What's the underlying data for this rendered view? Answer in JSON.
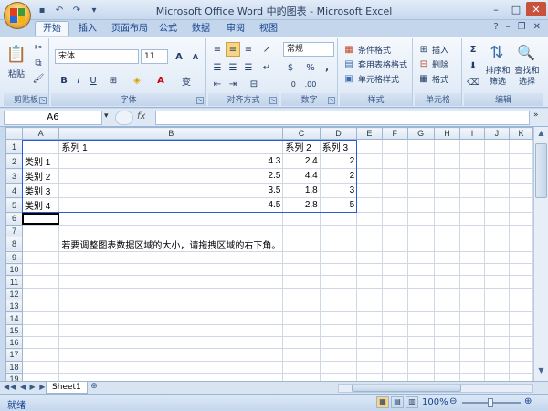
{
  "window": {
    "title": "Microsoft Office Word 中的图表 - Microsoft Excel",
    "minimize": "–",
    "maximize": "□",
    "close": "✕"
  },
  "tabs": [
    {
      "label": "开始",
      "active": true
    },
    {
      "label": "插入"
    },
    {
      "label": "页面布局"
    },
    {
      "label": "公式"
    },
    {
      "label": "数据"
    },
    {
      "label": "审阅"
    },
    {
      "label": "视图"
    }
  ],
  "ribbon": {
    "clipboard": {
      "label": "剪贴板",
      "paste": "粘贴"
    },
    "font": {
      "label": "字体",
      "name": "宋体",
      "size": "11",
      "bold": "B",
      "italic": "I",
      "underline": "U",
      "grow": "A",
      "shrink": "A",
      "color_letter": "A",
      "wen": "变"
    },
    "alignment": {
      "label": "对齐方式"
    },
    "number": {
      "label": "数字",
      "format": "常规",
      "percent": "%",
      "comma": ",",
      "currency": "$"
    },
    "styles": {
      "label": "样式",
      "conditional": "条件格式",
      "table": "套用表格格式",
      "cell": "单元格样式"
    },
    "cells": {
      "label": "单元格",
      "insert": "插入",
      "delete": "删除",
      "format": "格式"
    },
    "editing": {
      "label": "编辑",
      "sort": "排序和",
      "sort2": "筛选",
      "find": "查找和",
      "find2": "选择"
    }
  },
  "formula_bar": {
    "name_box": "A6",
    "fx": "fx",
    "value": ""
  },
  "grid": {
    "columns": [
      "A",
      "B",
      "C",
      "D",
      "E",
      "F",
      "G",
      "H",
      "I",
      "J",
      "K"
    ],
    "rows": [
      [
        "",
        "系列 1",
        "系列 2",
        "系列 3",
        "",
        "",
        "",
        "",
        "",
        "",
        ""
      ],
      [
        "类别 1",
        "4.3",
        "2.4",
        "2",
        "",
        "",
        "",
        "",
        "",
        "",
        ""
      ],
      [
        "类别 2",
        "2.5",
        "4.4",
        "2",
        "",
        "",
        "",
        "",
        "",
        "",
        ""
      ],
      [
        "类别 3",
        "3.5",
        "1.8",
        "3",
        "",
        "",
        "",
        "",
        "",
        "",
        ""
      ],
      [
        "类别 4",
        "4.5",
        "2.8",
        "5",
        "",
        "",
        "",
        "",
        "",
        "",
        ""
      ],
      [
        "",
        "",
        "",
        "",
        "",
        "",
        "",
        "",
        "",
        "",
        ""
      ],
      [
        "",
        "",
        "",
        "",
        "",
        "",
        "",
        "",
        "",
        "",
        ""
      ],
      [
        "",
        "若要调整图表数据区域的大小，请拖拽区域的右下角。",
        "",
        "",
        "",
        "",
        "",
        "",
        "",
        "",
        ""
      ],
      [
        "",
        "",
        "",
        "",
        "",
        "",
        "",
        "",
        "",
        "",
        ""
      ],
      [
        "",
        "",
        "",
        "",
        "",
        "",
        "",
        "",
        "",
        "",
        ""
      ],
      [
        "",
        "",
        "",
        "",
        "",
        "",
        "",
        "",
        "",
        "",
        ""
      ],
      [
        "",
        "",
        "",
        "",
        "",
        "",
        "",
        "",
        "",
        "",
        ""
      ],
      [
        "",
        "",
        "",
        "",
        "",
        "",
        "",
        "",
        "",
        "",
        ""
      ],
      [
        "",
        "",
        "",
        "",
        "",
        "",
        "",
        "",
        "",
        "",
        ""
      ],
      [
        "",
        "",
        "",
        "",
        "",
        "",
        "",
        "",
        "",
        "",
        ""
      ],
      [
        "",
        "",
        "",
        "",
        "",
        "",
        "",
        "",
        "",
        "",
        ""
      ],
      [
        "",
        "",
        "",
        "",
        "",
        "",
        "",
        "",
        "",
        "",
        ""
      ],
      [
        "",
        "",
        "",
        "",
        "",
        "",
        "",
        "",
        "",
        "",
        ""
      ],
      [
        "",
        "",
        "",
        "",
        "",
        "",
        "",
        "",
        "",
        "",
        ""
      ],
      [
        "",
        "",
        "",
        "",
        "",
        "",
        "",
        "",
        "",
        "",
        ""
      ]
    ]
  },
  "sheet_tabs": [
    {
      "label": "Sheet1",
      "active": true
    }
  ],
  "status": {
    "ready": "就绪",
    "zoom": "100%"
  }
}
